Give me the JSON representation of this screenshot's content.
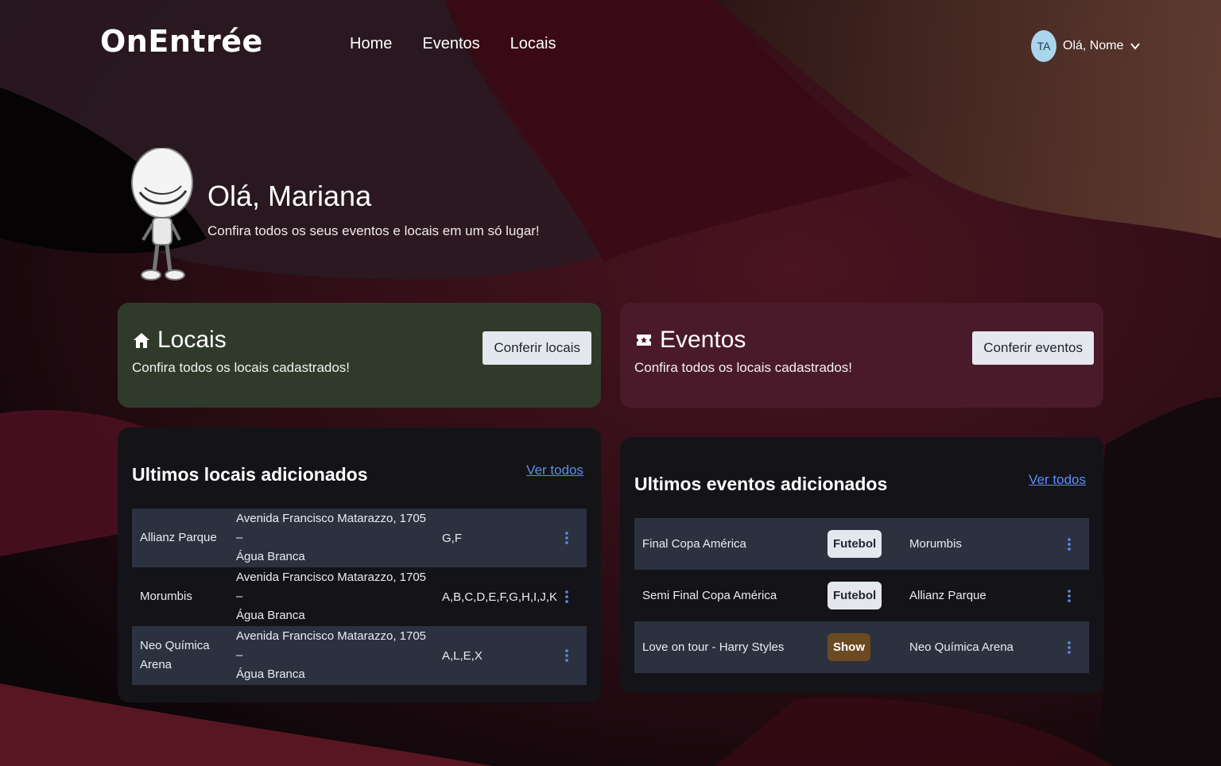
{
  "header": {
    "logo": "OnEntrée",
    "nav": [
      "Home",
      "Eventos",
      "Locais"
    ],
    "user_initials": "TA",
    "user_greeting": "Olá, Nome"
  },
  "greeting": {
    "title": "Olá, Mariana",
    "subtitle": "Confira todos os seus eventos e locais em um só lugar!"
  },
  "cards": {
    "locais": {
      "title": "Locais",
      "subtitle": "Confira todos os locais cadastrados!",
      "button": "Conferir locais",
      "color": "#303a2a"
    },
    "eventos": {
      "title": "Eventos",
      "subtitle": "Confira todos os locais cadastrados!",
      "button": "Conferir eventos",
      "color": "#4a1a2a"
    }
  },
  "locais_list": {
    "title": "Ultimos locais adicionados",
    "link": "Ver todos",
    "rows": [
      {
        "name": "Allianz Parque",
        "address_line1": "Avenida Francisco Matarazzo, 1705 –",
        "address_line2": "Água Branca",
        "sectors": "G,F"
      },
      {
        "name": "Morumbis",
        "address_line1": "Avenida Francisco Matarazzo, 1705 –",
        "address_line2": "Água Branca",
        "sectors": "A,B,C,D,E,F,G,H,I,J,K"
      },
      {
        "name_line1": "Neo Química",
        "name_line2": "Arena",
        "address_line1": "Avenida Francisco Matarazzo, 1705 –",
        "address_line2": "Água Branca",
        "sectors": "A,L,E,X"
      }
    ]
  },
  "eventos_list": {
    "title": "Ultimos eventos adicionados",
    "link": "Ver todos",
    "rows": [
      {
        "name": "Final Copa América",
        "category": "Futebol",
        "place": "Morumbis"
      },
      {
        "name": "Semi Final Copa América",
        "category": "Futebol",
        "place": "Allianz Parque"
      },
      {
        "name": "Love on tour - Harry Styles",
        "category": "Show",
        "place": "Neo Química Arena"
      }
    ]
  },
  "colors": {
    "link": "#5e8df0",
    "futebol_badge_bg": "#e4e8ee",
    "futebol_badge_text": "#1f2530",
    "show_badge_bg": "#6b4a22",
    "show_badge_text": "#ffffff"
  },
  "icons": {
    "locais": "house-icon",
    "eventos": "ticket-icon",
    "row_menu": "kebab-menu-icon",
    "user_menu": "chevron-down-icon"
  }
}
